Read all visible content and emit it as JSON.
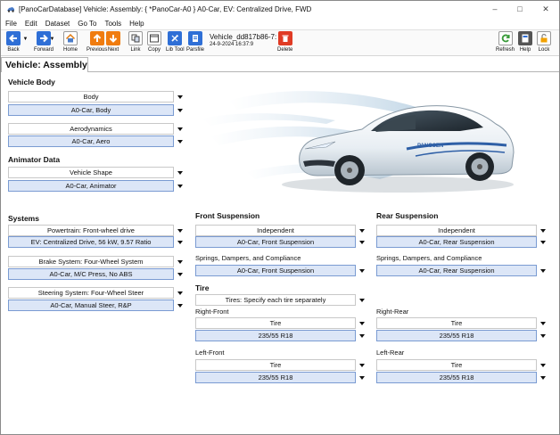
{
  "window": {
    "title": "[PanoCarDatabase] Vehicle: Assembly: { *PanoCar-A0 } A0-Car, EV: Centralized Drive, FWD",
    "controls": [
      "–",
      "□",
      "✕"
    ]
  },
  "menu": [
    "File",
    "Edit",
    "Dataset",
    "Go To",
    "Tools",
    "Help"
  ],
  "toolbar": {
    "back": "Back",
    "forward": "Forward",
    "home": "Home",
    "previous": "Previous",
    "next": "Next",
    "link": "Link",
    "copy": "Copy",
    "lib_tool": "Lib Tool",
    "parsfile": "Parsfile",
    "vehicle_name": "Vehicle_dd817b86-7:",
    "vehicle_date": "24-9-2024 16:37:9",
    "delete": "Delete",
    "refresh": "Refresh",
    "help": "Help",
    "lock": "Lock"
  },
  "page": {
    "title": "Vehicle: Assembly"
  },
  "vehicle_body": {
    "heading": "Vehicle Body",
    "body_type": "Body",
    "body_dataset": "A0-Car, Body",
    "aero_type": "Aerodynamics",
    "aero_dataset": "A0-Car, Aero"
  },
  "animator": {
    "heading": "Animator Data",
    "shape_type": "Vehicle Shape",
    "shape_dataset": "A0-Car, Animator"
  },
  "systems": {
    "heading": "Systems",
    "powertrain_type": "Powertrain: Front-wheel drive",
    "powertrain_dataset": "EV: Centralized Drive, 56 kW, 9.57 Ratio",
    "brake_type": "Brake System: Four-Wheel System",
    "brake_dataset": "A0-Car, M/C Press, No ABS",
    "steering_type": "Steering System: Four-Wheel Steer",
    "steering_dataset": "A0-Car, Manual Steer, R&P"
  },
  "front_suspension": {
    "heading": "Front Suspension",
    "kin_type": "Independent",
    "kin_dataset": "A0-Car, Front Suspension",
    "compliance_label": "Springs, Dampers, and Compliance",
    "compliance_dataset": "A0-Car, Front Suspension"
  },
  "rear_suspension": {
    "heading": "Rear Suspension",
    "kin_type": "Independent",
    "kin_dataset": "A0-Car, Rear Suspension",
    "compliance_label": "Springs, Dampers, and Compliance",
    "compliance_dataset": "A0-Car, Rear Suspension"
  },
  "tire": {
    "heading": "Tire",
    "mode": "Tires: Specify each tire separately",
    "right_front_label": "Right-Front",
    "right_front_type": "Tire",
    "right_front_dataset": "235/55 R18",
    "right_rear_label": "Right-Rear",
    "right_rear_type": "Tire",
    "right_rear_dataset": "235/55 R18",
    "left_front_label": "Left-Front",
    "left_front_type": "Tire",
    "left_front_dataset": "235/55 R18",
    "left_rear_label": "Left-Rear",
    "left_rear_type": "Tire",
    "left_rear_dataset": "235/55 R18"
  },
  "car_image": {
    "brand_text": "PANOSEN"
  },
  "colors": {
    "dataset_field": "#dce6f7",
    "dataset_border": "#7a9bd2",
    "nav_blue": "#2f6fd6",
    "nav_orange": "#f07c0f",
    "delete_red": "#e03b24",
    "refresh_green": "#3a9b3a",
    "lock_orange": "#f2a100"
  }
}
